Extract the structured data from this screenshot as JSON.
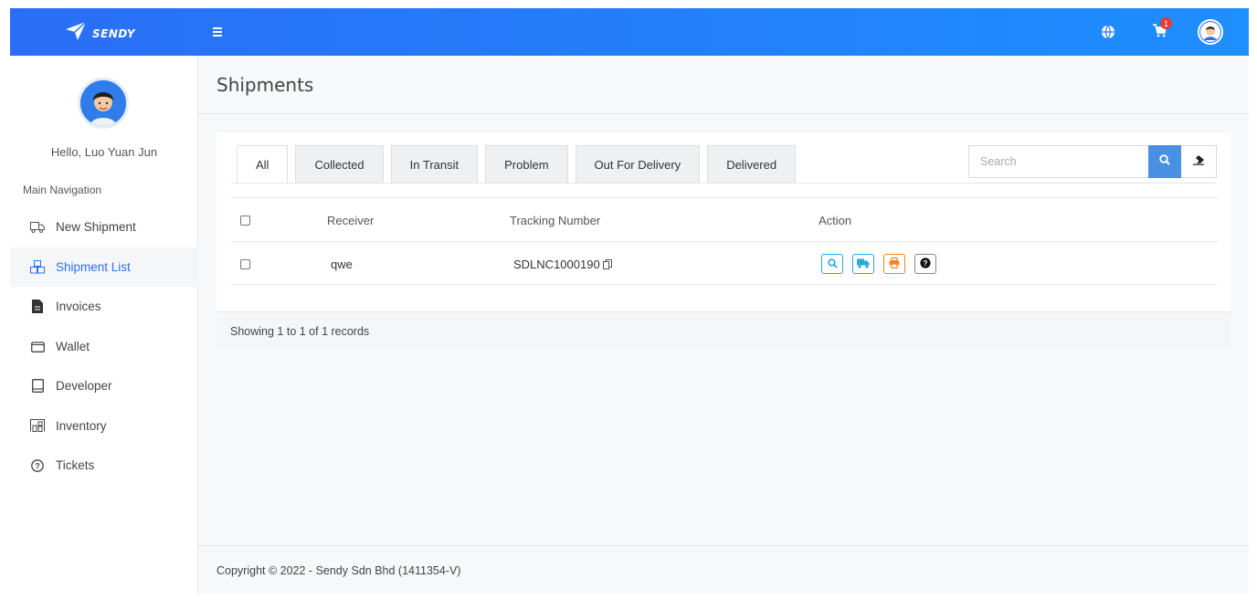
{
  "brand": {
    "name": "SENDY"
  },
  "topbar": {
    "cart_count": "1"
  },
  "sidebar": {
    "greeting": "Hello, Luo Yuan Jun",
    "nav_title": "Main Navigation",
    "items": [
      {
        "label": "New Shipment",
        "icon": "truck-icon",
        "active": false
      },
      {
        "label": "Shipment List",
        "icon": "boxes-icon",
        "active": true
      },
      {
        "label": "Invoices",
        "icon": "invoice-icon",
        "active": false
      },
      {
        "label": "Wallet",
        "icon": "wallet-icon",
        "active": false
      },
      {
        "label": "Developer",
        "icon": "book-icon",
        "active": false
      },
      {
        "label": "Inventory",
        "icon": "warehouse-icon",
        "active": false
      },
      {
        "label": "Tickets",
        "icon": "question-circle-icon",
        "active": false
      }
    ]
  },
  "page": {
    "title": "Shipments"
  },
  "tabs": [
    {
      "label": "All",
      "active": true
    },
    {
      "label": "Collected",
      "active": false
    },
    {
      "label": "In Transit",
      "active": false
    },
    {
      "label": "Problem",
      "active": false
    },
    {
      "label": "Out For Delivery",
      "active": false
    },
    {
      "label": "Delivered",
      "active": false
    }
  ],
  "search": {
    "placeholder": "Search",
    "value": ""
  },
  "table": {
    "headers": {
      "receiver": "Receiver",
      "tracking": "Tracking Number",
      "action": "Action"
    },
    "rows": [
      {
        "receiver": "qwe",
        "tracking": "SDLNC1000190"
      }
    ]
  },
  "records_text": "Showing 1 to 1 of 1 records",
  "footer": {
    "copyright": "Copyright © 2022 - Sendy Sdn Bhd (1411354-V)"
  },
  "colors": {
    "primary": "#2a6ef5",
    "accent": "#4a90e2",
    "view": "#29a8e0",
    "print": "#f58220",
    "active_nav": "#2a74e8"
  }
}
